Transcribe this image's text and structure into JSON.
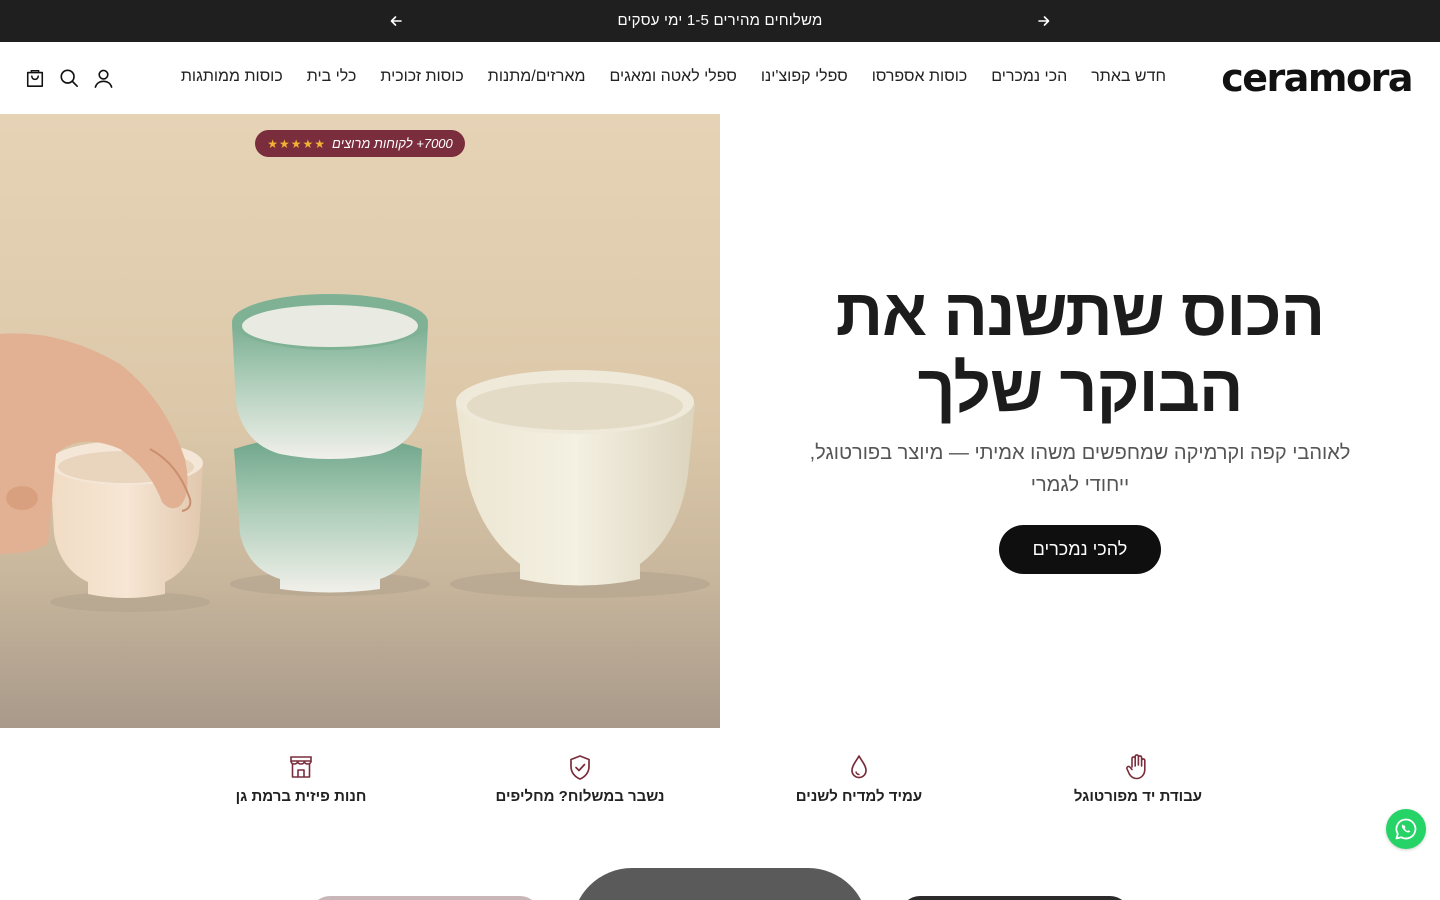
{
  "announcement": {
    "text": "משלוחים מהירים 1-5 ימי עסקים",
    "prev_icon": "arrow-left-icon",
    "next_icon": "arrow-right-icon"
  },
  "header": {
    "logo": "ceramora",
    "nav": [
      "חדש באתר",
      "הכי נמכרים",
      "כוסות אספרסו",
      "ספלי קפוצ'ינו",
      "ספלי לאטה ומאגים",
      "מארזים/מתנות",
      "כוסות זכוכית",
      "כלי בית",
      "כוסות ממותגות"
    ],
    "icons": [
      "account-icon",
      "search-icon",
      "cart-icon"
    ]
  },
  "hero": {
    "badge_stars": "★★★★★",
    "badge_text": "7000+ לקוחות מרוצים",
    "title_line1": "הכוס שתשנה את",
    "title_line2": "הבוקר שלך",
    "subtitle": "לאוהבי קפה וקרמיקה שמחפשים משהו אמיתי — מיוצר בפורטוגל, ייחודי לגמרי",
    "cta": "להכי נמכרים"
  },
  "features": [
    {
      "icon": "hand-icon",
      "label": "עבודת יד מפורטוגל"
    },
    {
      "icon": "droplet-icon",
      "label": "עמיד למדיח לשנים"
    },
    {
      "icon": "shield-check-icon",
      "label": "נשבר במשלוח? מחליפים"
    },
    {
      "icon": "store-icon",
      "label": "חנות פיזית ברמת גן"
    }
  ],
  "colors": {
    "announcement_bg": "#1f1f1f",
    "accent": "#7a2d3c",
    "cta_bg": "#0f0f0f",
    "whatsapp": "#25d366"
  },
  "whatsapp_icon": "whatsapp-icon"
}
